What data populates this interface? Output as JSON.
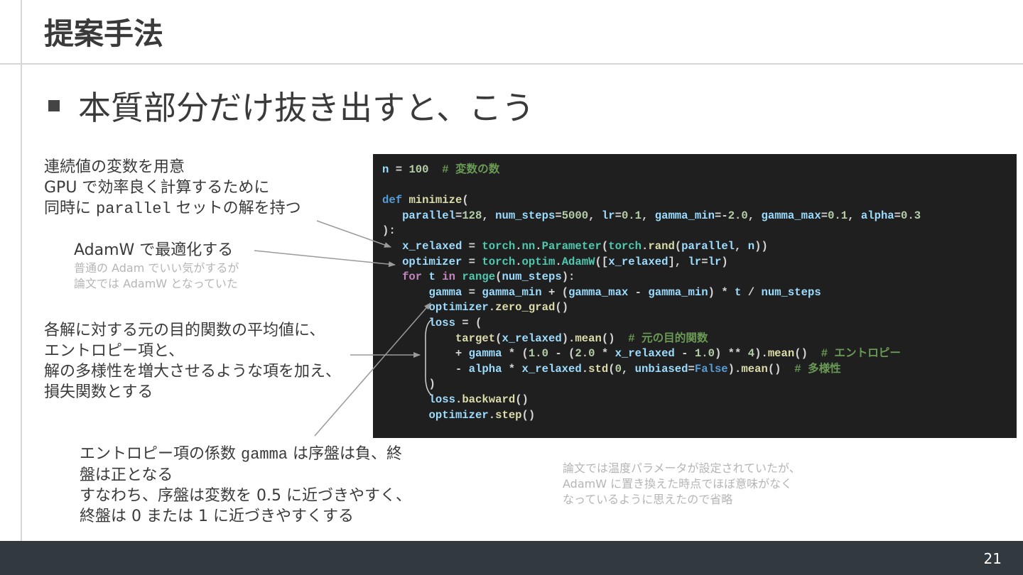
{
  "slide": {
    "title": "提案手法",
    "bullet": "本質部分だけ抜き出すと、こう",
    "page_number": "21"
  },
  "notes": {
    "n1": {
      "l1": "連続値の変数を用意",
      "l2": "GPU で効率良く計算するために",
      "l3a": "同時に ",
      "l3code": "parallel",
      "l3b": " セットの解を持つ"
    },
    "n2": {
      "l1": "AdamW で最適化する",
      "s1": "普通の Adam でいい気がするが",
      "s2": "論文では AdamW となっていた"
    },
    "n3": {
      "l1": "各解に対する元の目的関数の平均値に、",
      "l2": "エントロピー項と、",
      "l3": "解の多様性を増大させるような項を加え、",
      "l4": "損失関数とする"
    },
    "n4": {
      "l1a": "エントロピー項の係数 ",
      "l1code": "gamma",
      "l1b": " は序盤は負、終",
      "l2": "盤は正となる",
      "l3": "すなわち、序盤は変数を 0.5 に近づきやすく、",
      "l4": "終盤は 0 または 1 に近づきやすくする"
    },
    "n5": {
      "l1": "論文では温度パラメータが設定されていたが、",
      "l2": "AdamW に置き換えた時点でほぼ意味がなく",
      "l3": "なっているように思えたので省略"
    }
  },
  "colors": {
    "code_bg": "#1f1f1f",
    "keyword": "#569cd6",
    "control": "#c586c0",
    "variable": "#9cdcfe",
    "number": "#b5cea8",
    "function": "#dcdcaa",
    "class": "#4ec9b0",
    "comment": "#6a9955",
    "punct": "#d4d4d4",
    "footer": "#333a3f"
  },
  "code_lines": [
    [
      [
        "v",
        "n"
      ],
      [
        "p",
        " = "
      ],
      [
        "n",
        "100"
      ],
      [
        "p",
        "  "
      ],
      [
        "c",
        "# 変数の数"
      ]
    ],
    [],
    [
      [
        "k",
        "def"
      ],
      [
        "p",
        " "
      ],
      [
        "f",
        "minimize"
      ],
      [
        "p",
        "("
      ]
    ],
    [
      [
        "p",
        "   "
      ],
      [
        "v",
        "parallel"
      ],
      [
        "p",
        "="
      ],
      [
        "n",
        "128"
      ],
      [
        "p",
        ", "
      ],
      [
        "v",
        "num_steps"
      ],
      [
        "p",
        "="
      ],
      [
        "n",
        "5000"
      ],
      [
        "p",
        ", "
      ],
      [
        "v",
        "lr"
      ],
      [
        "p",
        "="
      ],
      [
        "n",
        "0.1"
      ],
      [
        "p",
        ", "
      ],
      [
        "v",
        "gamma_min"
      ],
      [
        "p",
        "=-"
      ],
      [
        "n",
        "2.0"
      ],
      [
        "p",
        ", "
      ],
      [
        "v",
        "gamma_max"
      ],
      [
        "p",
        "="
      ],
      [
        "n",
        "0.1"
      ],
      [
        "p",
        ", "
      ],
      [
        "v",
        "alpha"
      ],
      [
        "p",
        "="
      ],
      [
        "n",
        "0.3"
      ]
    ],
    [
      [
        "p",
        "):"
      ]
    ],
    [
      [
        "p",
        "   "
      ],
      [
        "v",
        "x_relaxed"
      ],
      [
        "p",
        " = "
      ],
      [
        "t",
        "torch"
      ],
      [
        "p",
        "."
      ],
      [
        "t",
        "nn"
      ],
      [
        "p",
        "."
      ],
      [
        "t",
        "Parameter"
      ],
      [
        "p",
        "("
      ],
      [
        "t",
        "torch"
      ],
      [
        "p",
        "."
      ],
      [
        "f",
        "rand"
      ],
      [
        "p",
        "("
      ],
      [
        "v",
        "parallel"
      ],
      [
        "p",
        ", "
      ],
      [
        "v",
        "n"
      ],
      [
        "p",
        "))"
      ]
    ],
    [
      [
        "p",
        "   "
      ],
      [
        "v",
        "optimizer"
      ],
      [
        "p",
        " = "
      ],
      [
        "t",
        "torch"
      ],
      [
        "p",
        "."
      ],
      [
        "t",
        "optim"
      ],
      [
        "p",
        "."
      ],
      [
        "t",
        "AdamW"
      ],
      [
        "p",
        "(["
      ],
      [
        "v",
        "x_relaxed"
      ],
      [
        "p",
        "], "
      ],
      [
        "v",
        "lr"
      ],
      [
        "p",
        "="
      ],
      [
        "v",
        "lr"
      ],
      [
        "p",
        ")"
      ]
    ],
    [
      [
        "p",
        "   "
      ],
      [
        "x",
        "for"
      ],
      [
        "p",
        " "
      ],
      [
        "v",
        "t"
      ],
      [
        "p",
        " "
      ],
      [
        "x",
        "in"
      ],
      [
        "p",
        " "
      ],
      [
        "t",
        "range"
      ],
      [
        "p",
        "("
      ],
      [
        "v",
        "num_steps"
      ],
      [
        "p",
        "):"
      ]
    ],
    [
      [
        "p",
        "       "
      ],
      [
        "v",
        "gamma"
      ],
      [
        "p",
        " = "
      ],
      [
        "v",
        "gamma_min"
      ],
      [
        "p",
        " + ("
      ],
      [
        "v",
        "gamma_max"
      ],
      [
        "p",
        " - "
      ],
      [
        "v",
        "gamma_min"
      ],
      [
        "p",
        ") * "
      ],
      [
        "v",
        "t"
      ],
      [
        "p",
        " / "
      ],
      [
        "v",
        "num_steps"
      ]
    ],
    [
      [
        "p",
        "       "
      ],
      [
        "v",
        "optimizer"
      ],
      [
        "p",
        "."
      ],
      [
        "f",
        "zero_grad"
      ],
      [
        "p",
        "()"
      ]
    ],
    [
      [
        "p",
        "       "
      ],
      [
        "v",
        "loss"
      ],
      [
        "p",
        " = ("
      ]
    ],
    [
      [
        "p",
        "           "
      ],
      [
        "f",
        "target"
      ],
      [
        "p",
        "("
      ],
      [
        "v",
        "x_relaxed"
      ],
      [
        "p",
        ")."
      ],
      [
        "f",
        "mean"
      ],
      [
        "p",
        "()  "
      ],
      [
        "c",
        "# 元の目的関数"
      ]
    ],
    [
      [
        "p",
        "           + "
      ],
      [
        "v",
        "gamma"
      ],
      [
        "p",
        " * ("
      ],
      [
        "n",
        "1.0"
      ],
      [
        "p",
        " - ("
      ],
      [
        "n",
        "2.0"
      ],
      [
        "p",
        " * "
      ],
      [
        "v",
        "x_relaxed"
      ],
      [
        "p",
        " - "
      ],
      [
        "n",
        "1.0"
      ],
      [
        "p",
        ") ** "
      ],
      [
        "n",
        "4"
      ],
      [
        "p",
        ")."
      ],
      [
        "f",
        "mean"
      ],
      [
        "p",
        "()  "
      ],
      [
        "c",
        "# エントロピー"
      ]
    ],
    [
      [
        "p",
        "           - "
      ],
      [
        "v",
        "alpha"
      ],
      [
        "p",
        " * "
      ],
      [
        "v",
        "x_relaxed"
      ],
      [
        "p",
        "."
      ],
      [
        "f",
        "std"
      ],
      [
        "p",
        "("
      ],
      [
        "n",
        "0"
      ],
      [
        "p",
        ", "
      ],
      [
        "v",
        "unbiased"
      ],
      [
        "p",
        "="
      ],
      [
        "k",
        "False"
      ],
      [
        "p",
        ")."
      ],
      [
        "f",
        "mean"
      ],
      [
        "p",
        "()  "
      ],
      [
        "c",
        "# 多様性"
      ]
    ],
    [
      [
        "p",
        "       )"
      ]
    ],
    [
      [
        "p",
        "       "
      ],
      [
        "v",
        "loss"
      ],
      [
        "p",
        "."
      ],
      [
        "f",
        "backward"
      ],
      [
        "p",
        "()"
      ]
    ],
    [
      [
        "p",
        "       "
      ],
      [
        "v",
        "optimizer"
      ],
      [
        "p",
        "."
      ],
      [
        "f",
        "step"
      ],
      [
        "p",
        "()"
      ]
    ]
  ]
}
